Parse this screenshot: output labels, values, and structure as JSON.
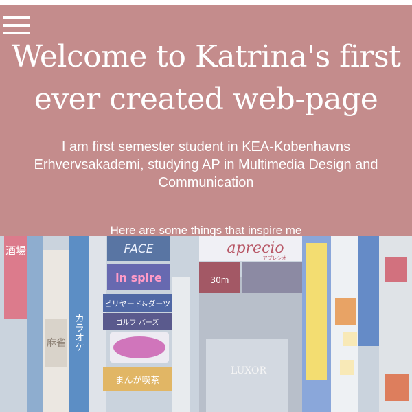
{
  "header": {
    "menu_icon": "hamburger-menu-icon",
    "title_line1": "Welcome to Katrina's first",
    "title_line2": "ever created web-page",
    "intro_line1": "I am first semester student in KEA-Kobenhavns",
    "intro_line2": "Erhvervsakademi, studying AP in Multimedia Design and",
    "intro_line3": "Communication",
    "inspire_text": "Here are some things that inspire me",
    "background_color": "#c48c8c"
  },
  "photo": {
    "subject": "Neon street signs in Tokyo",
    "signs": {
      "sign_face": "FACE",
      "sign_aprecio": "aprecio",
      "sign_aprecio_kana": "アプレシオ",
      "sign_in_spire": "in spire",
      "sign_billiards": "ビリヤード&ダーツ",
      "sign_golf": "ゴルフ バーズ",
      "sign_karaoke": "カラオケ",
      "sign_manga": "まんが喫茶",
      "sign_30m": "30m",
      "sign_luxor": "LUXOR",
      "sign_sakaba": "酒場",
      "sign_mahjong": "麻雀"
    }
  }
}
